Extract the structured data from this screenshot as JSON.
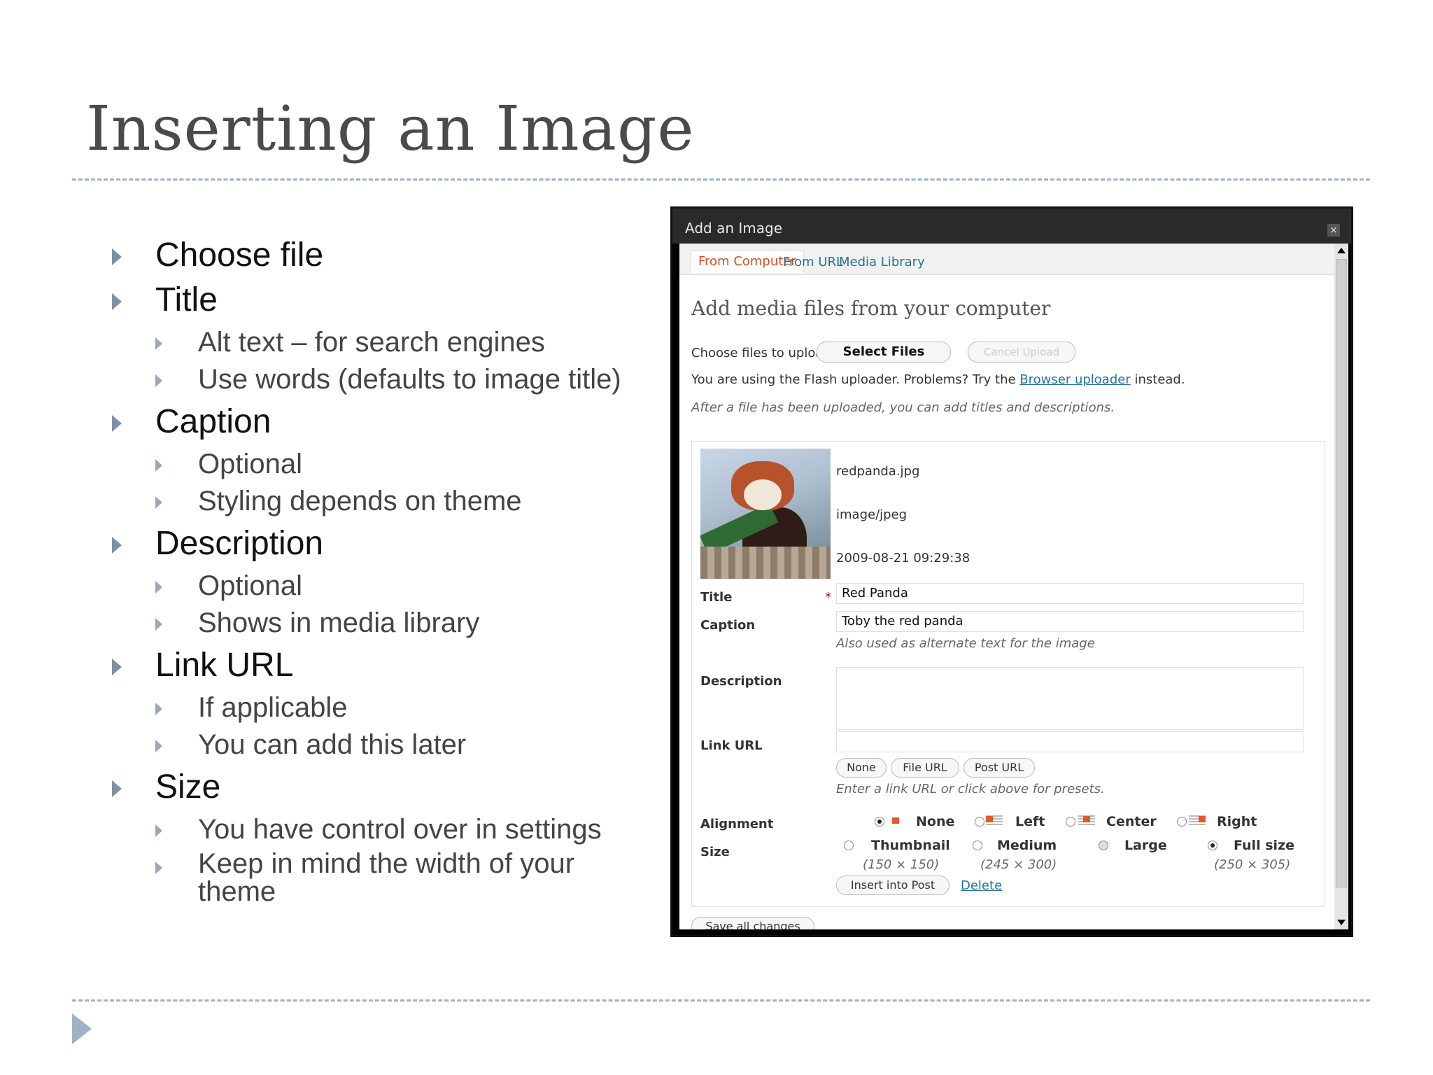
{
  "slide": {
    "title": "Inserting an Image",
    "bullets": [
      {
        "label": "Choose file",
        "subs": []
      },
      {
        "label": "Title",
        "subs": [
          "Alt text – for search engines",
          "Use words (defaults to image title)"
        ]
      },
      {
        "label": "Caption",
        "subs": [
          "Optional",
          "Styling depends on theme"
        ]
      },
      {
        "label": "Description",
        "subs": [
          "Optional",
          "Shows in media library"
        ]
      },
      {
        "label": "Link URL",
        "subs": [
          "If applicable",
          "You can add this later"
        ]
      },
      {
        "label": "Size",
        "subs": [
          "You have control over in settings",
          "Keep in mind the width of your theme"
        ]
      }
    ]
  },
  "dialog": {
    "title": "Add an Image",
    "close_glyph": "×",
    "tabs": [
      "From Computer",
      "From URL",
      "Media Library"
    ],
    "heading": "Add media files from your computer",
    "choose_label": "Choose files to upload",
    "select_button": "Select Files",
    "cancel_button": "Cancel Upload",
    "flash_text_before": "You are using the Flash uploader. Problems? Try the ",
    "flash_link": "Browser uploader",
    "flash_text_after": " instead.",
    "after_upload_note": "After a file has been uploaded, you can add titles and descriptions.",
    "file": {
      "name": "redpanda.jpg",
      "mime": "image/jpeg",
      "date": "2009-08-21 09:29:38"
    },
    "fields": {
      "title_label": "Title",
      "title_value": "Red Panda",
      "required_mark": "*",
      "caption_label": "Caption",
      "caption_value": "Toby the red panda",
      "caption_hint": "Also used as alternate text for the image",
      "description_label": "Description",
      "link_label": "Link URL",
      "link_buttons": [
        "None",
        "File URL",
        "Post URL"
      ],
      "link_hint": "Enter a link URL or click above for presets.",
      "alignment_label": "Alignment",
      "alignment_options": [
        "None",
        "Left",
        "Center",
        "Right"
      ],
      "size_label": "Size",
      "size_options": [
        "Thumbnail",
        "Medium",
        "Large",
        "Full size"
      ],
      "size_dims": [
        "(150 × 150)",
        "(245 × 300)",
        "(250 × 305)"
      ],
      "insert_button": "Insert into Post",
      "delete_link": "Delete",
      "save_button": "Save all changes"
    }
  }
}
